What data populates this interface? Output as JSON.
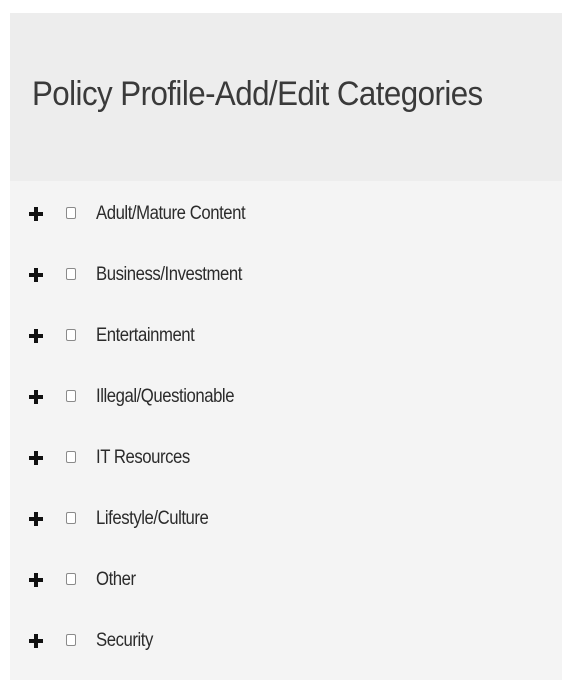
{
  "header": {
    "title": "Policy Profile-Add/Edit Categories"
  },
  "categories": [
    {
      "label": "Adult/Mature Content",
      "expander_icon": "plus-icon",
      "checked": false
    },
    {
      "label": "Business/Investment",
      "expander_icon": "plus-icon",
      "checked": false
    },
    {
      "label": "Entertainment",
      "expander_icon": "plus-icon",
      "checked": false
    },
    {
      "label": "Illegal/Questionable",
      "expander_icon": "plus-icon",
      "checked": false
    },
    {
      "label": "IT Resources",
      "expander_icon": "plus-icon",
      "checked": false
    },
    {
      "label": "Lifestyle/Culture",
      "expander_icon": "plus-icon",
      "checked": false
    },
    {
      "label": "Other",
      "expander_icon": "plus-icon",
      "checked": false
    },
    {
      "label": "Security",
      "expander_icon": "plus-icon",
      "checked": false
    }
  ],
  "colors": {
    "header_bg": "#ededed",
    "panel_bg": "#f4f4f4",
    "title_text": "#3a3a3a",
    "label_text": "#2b2b2b",
    "expander": "#111111",
    "checkbox_border": "#8a8a8a"
  }
}
